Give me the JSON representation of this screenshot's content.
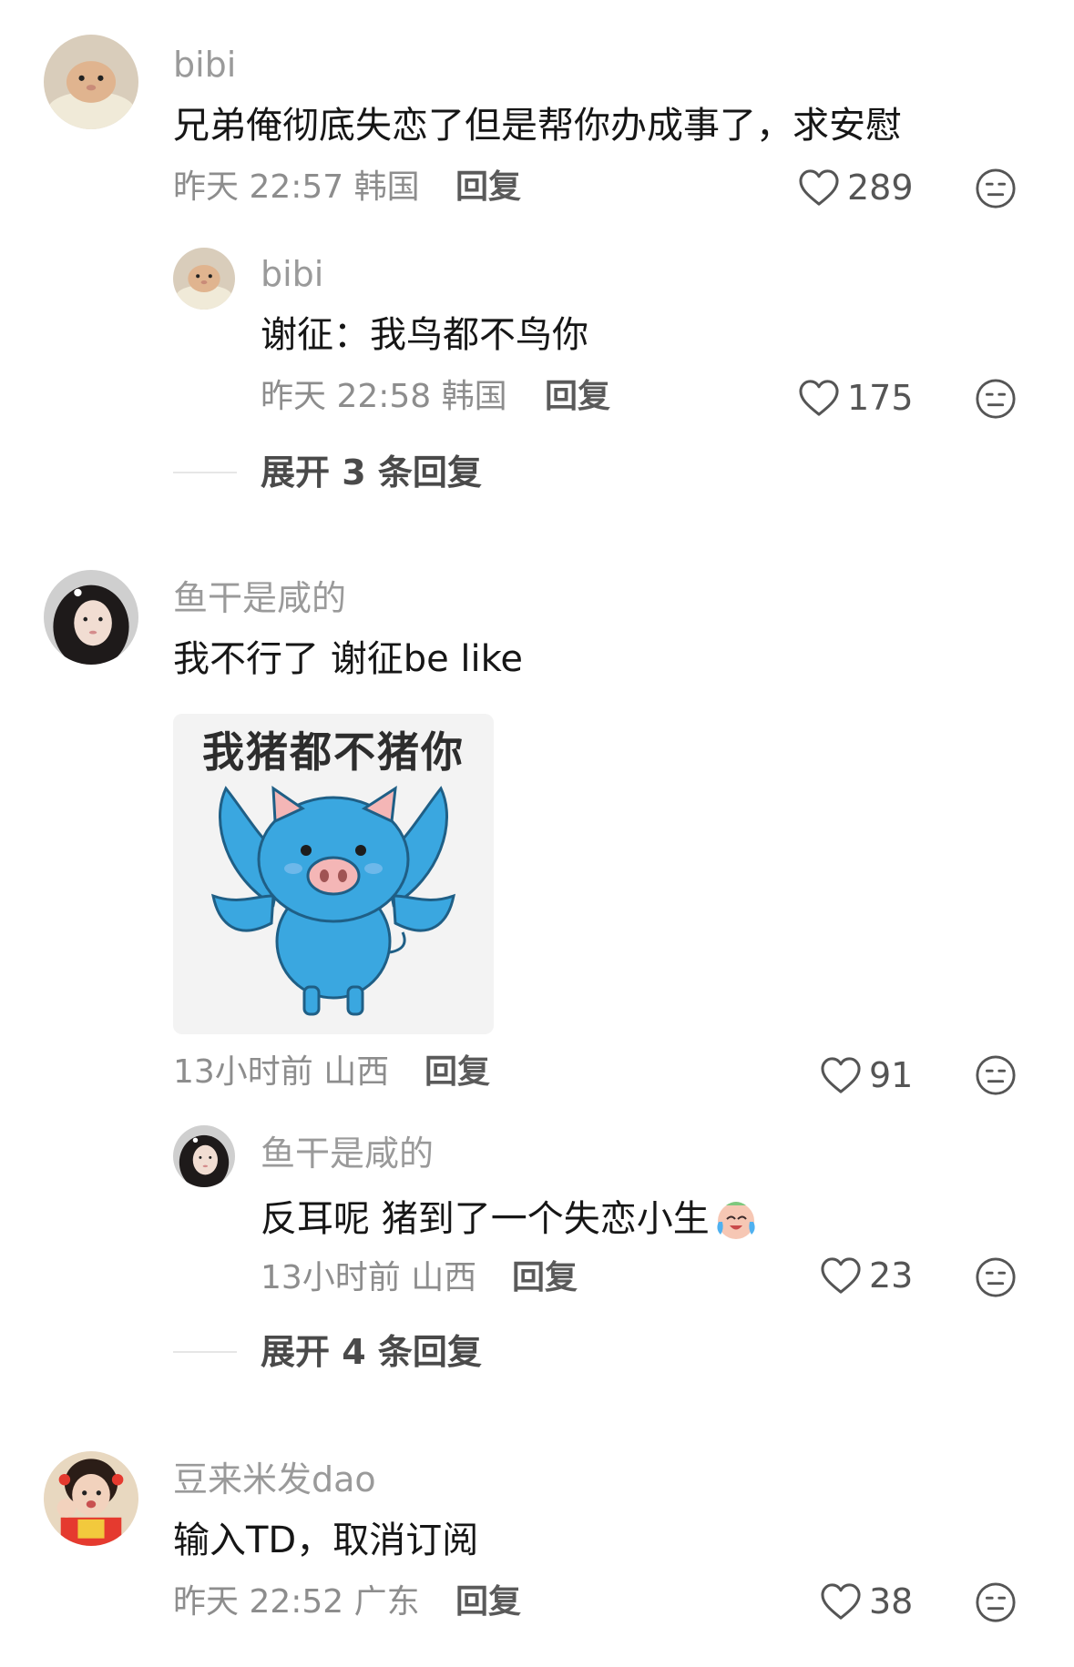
{
  "comments": [
    {
      "user": "bibi",
      "text": "兄弟俺彻底失恋了但是帮你办成事了，求安慰",
      "time": "昨天 22:57",
      "location": "韩国",
      "reply_label": "回复",
      "likes": "289",
      "reply": {
        "user": "bibi",
        "text": "谢征：我鸟都不鸟你",
        "time": "昨天 22:58",
        "location": "韩国",
        "reply_label": "回复",
        "likes": "175"
      },
      "expand_label": "展开 3 条回复"
    },
    {
      "user": "鱼干是咸的",
      "text": "我不行了 谢征be like",
      "sticker_text": "我猪都不猪你",
      "time": "13小时前",
      "location": "山西",
      "reply_label": "回复",
      "likes": "91",
      "reply": {
        "user": "鱼干是咸的",
        "text": "反耳呢 猪到了一个失恋小生",
        "emoji": "crying-laughing-emoji",
        "time": "13小时前",
        "location": "山西",
        "reply_label": "回复",
        "likes": "23"
      },
      "expand_label": "展开 4 条回复"
    },
    {
      "user": "豆来米发dao",
      "text": "输入TD，取消订阅",
      "time": "昨天 22:52",
      "location": "广东",
      "reply_label": "回复",
      "likes": "38"
    }
  ],
  "icons": {
    "like": "heart-outline-icon",
    "dislike": "neutral-face-icon"
  },
  "colors": {
    "background": "#ffffff",
    "name": "#9a9a9a",
    "meta": "#8d8d8d",
    "sticker_pig": "#3aa7e0"
  }
}
